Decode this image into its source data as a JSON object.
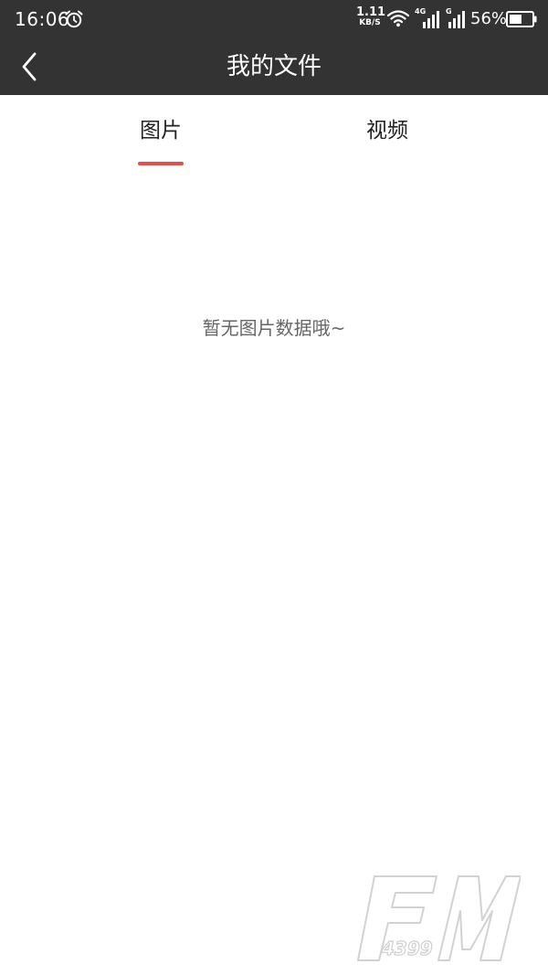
{
  "status_bar": {
    "time": "16:06",
    "net_speed_value": "1.11",
    "net_speed_unit": "KB/S",
    "sig1_label": "4G",
    "sig2_label": "G",
    "battery_percent": "56%",
    "battery_level": 0.56,
    "icons": [
      "alarm-icon",
      "wifi-icon",
      "signal-4g-icon",
      "signal-g-icon",
      "battery-icon"
    ]
  },
  "header": {
    "title": "我的文件",
    "back_icon": "chevron-left-icon"
  },
  "tabs": [
    {
      "label": "图片",
      "active": true
    },
    {
      "label": "视频",
      "active": false
    }
  ],
  "empty_state": {
    "message": "暂无图片数据哦~"
  },
  "watermark": {
    "text": "FM4399"
  },
  "colors": {
    "bar_background": "#333333",
    "accent": "#e84c4c",
    "muted_text": "#666666"
  }
}
